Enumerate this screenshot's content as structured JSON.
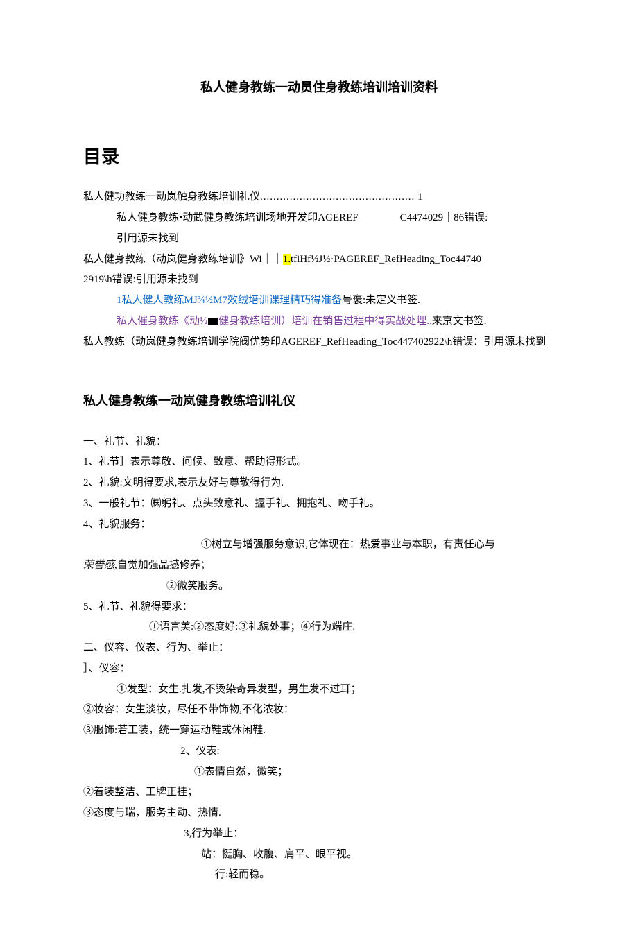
{
  "title": "私人健身教练一动员住身教练培训培训资料",
  "toc": {
    "heading": "目录",
    "entry1_text": "私人健功教练一动岚触身教练培训礼仪",
    "entry1_dots": "...............................................",
    "entry1_page": "1",
    "entry2_text_a": "私人健身教练•动武健身教练培训场地开发印AGEREF",
    "entry2_text_b": "C4474029｜86错误:",
    "entry2_sub": "引用源未找到",
    "entry3_a": "私人健身教练（动岚健身教练培训》Wi｜｜",
    "entry3_hl": "1.",
    "entry3_b": "tfiHf½J½·PAGEREF_RefHeading_Toc44740",
    "entry3_c": "2919\\h错误:引用源未找到",
    "entry4_link": "1私人健人教练MJ¾½M7效绒培训课理精巧得准备",
    "entry4_tail": "号褒:未定义书签.",
    "entry5_link_a": "私人催身教练《动½",
    "entry5_link_b": "健身教练培训）培训在销售过程中得实战处埋..",
    "entry5_tail": "来京文书签.",
    "entry6": "私人教练（动岚健身教练培训学院阀优势印AGEREF_RefHeading_Toc447402922\\h错误：引用源未找到"
  },
  "section": {
    "heading": "私人健身教练一动岚健身教练培训礼仪",
    "lines": {
      "l1": "一、礼节、礼貌：",
      "l2": "1、礼节］表示尊敬、问候、致意、帮助得形式。",
      "l3": "2、礼貌:文明得要求,表示友好与尊敬得行为.",
      "l4": "3、一般礼节：㈱躬礼、点头致意礼、握手礼、拥抱礼、吻手礼。",
      "l5": "4、礼貌服务：",
      "l6a": "①树立与增强服务意识,它体现在：热爱事业与本职，有责任心与",
      "l6b_a": "荣誉感,",
      "l6b_b": "自觉加强品撼修养；",
      "l7": "②微笑服务。",
      "l8": "5、礼节、礼貌得要求：",
      "l9": "①语言美:②态度好:③礼貌处事；④行为端庄.",
      "l10": "二、仪容、仪表、行为、举止：",
      "l11": "］、仪容：",
      "l12": "①发型：女生.扎发,不烫染奇异发型，男生发不过耳；",
      "l13": "②妆容：女生淡妆，尽任不带饰物,不化浓妆：",
      "l14": "③服饰:若工装，统一穿运动鞋或休闲鞋.",
      "l15": "2、仪表:",
      "l16": "①表情自然，微笑；",
      "l17": "②着装整洁、工牌正挂；",
      "l18": "③态度与瑞，服务主动、热情.",
      "l19": "3,行为举止：",
      "l20": "站：挺胸、收腹、肩平、眼平视。",
      "l21": "行:轻而稳。"
    }
  }
}
